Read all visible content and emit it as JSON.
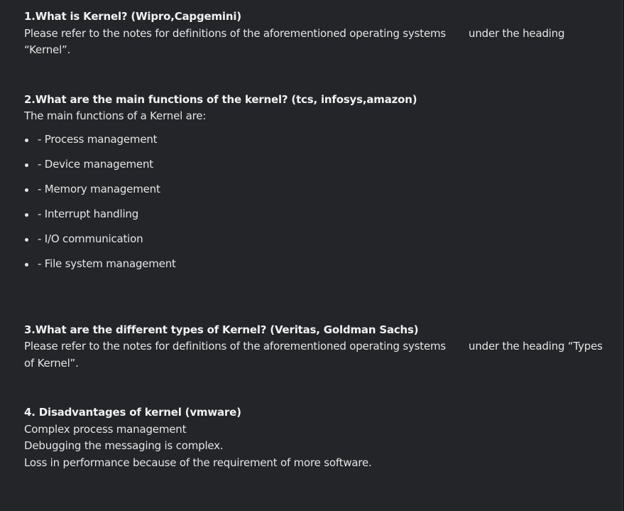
{
  "q1": {
    "title": "1.What is Kernel? (Wipro,Capgemini)",
    "para_part1": " Please refer to the notes for definitions of the aforementioned operating systems",
    "para_part2": "under the heading",
    "para_line2": "“Kernel”."
  },
  "q2": {
    "title": "2.What are the main functions of the kernel? (tcs, infosys,amazon)",
    "intro": "The main functions of a Kernel are:",
    "items": [
      "- Process management",
      "- Device management",
      "- Memory management",
      "- Interrupt handling",
      "- I/O communication",
      "- File system management"
    ]
  },
  "q3": {
    "title": "3.What are the different types of Kernel? (Veritas, Goldman Sachs)",
    "para_part1": " Please refer to the notes for definitions of the aforementioned operating systems",
    "para_part2": "under the heading “Types",
    "para_line2": "of Kernel”."
  },
  "q4": {
    "title": "4. Disadvantages of kernel (vmware)",
    "lines": [
      "Complex process management",
      "Debugging the messaging is complex.",
      "Loss in performance because of the requirement of more software."
    ]
  }
}
